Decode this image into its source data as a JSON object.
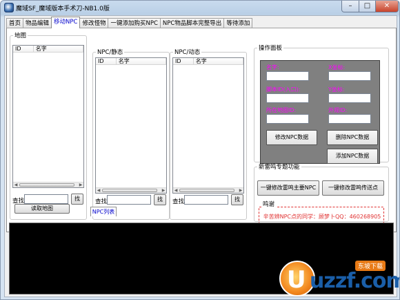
{
  "window": {
    "title": "魔域SF_魔域版本手术刀-NB1.0版",
    "min": "–",
    "max": "□",
    "close": "✕"
  },
  "tabs": [
    {
      "label": "首页"
    },
    {
      "label": "物品编辑"
    },
    {
      "label": "移动NPC"
    },
    {
      "label": "修改怪物"
    },
    {
      "label": "一键添加购买NPC"
    },
    {
      "label": "NPC物品脚本完整导出"
    },
    {
      "label": "等待添加"
    }
  ],
  "active_tab": "移动NPC",
  "map_group": {
    "legend": "地图",
    "columns": [
      "ID",
      "名字"
    ],
    "search_label": "查找",
    "search_value": "",
    "find_button": "找",
    "read_map_button": "读取地图"
  },
  "npc_static_group": {
    "legend": "NPC/静态",
    "columns": [
      "ID",
      "名字"
    ],
    "search_label": "查找",
    "search_value": "",
    "find_button": "找"
  },
  "npc_dynamic_group": {
    "legend": "NPC/动态",
    "columns": [
      "ID",
      "名字"
    ],
    "search_label": "查找",
    "search_value": "",
    "find_button": "找"
  },
  "npc_list_tab": "NPC列表",
  "ops_panel": {
    "legend": "操作面板",
    "fields": [
      {
        "label": "名字:",
        "value": ""
      },
      {
        "label": "X坐标:",
        "value": ""
      },
      {
        "label": "脚本ID(入口):",
        "value": ""
      },
      {
        "label": "Y坐标:",
        "value": ""
      },
      {
        "label": "所在地图ID:",
        "value": ""
      },
      {
        "label": "外观ID:",
        "value": ""
      }
    ],
    "modify_button": "修改NPC数据",
    "delete_button": "删除NPC数据",
    "add_button": "添加NPC数据"
  },
  "leiming_group": {
    "legend": "新雷鸣专题功能",
    "modify_main_button": "一键修改雷鸣主要NPC",
    "modify_teleport_button": "一键修改雷鸣传送点",
    "thanks_legend": "鸣谢",
    "thanks_text": "辛苦辨NPC点的同学：顾梦卜QQ：460268905"
  },
  "watermark": {
    "logo_letter": "U",
    "brand": "uzzf.com",
    "tag": "东坡下载"
  },
  "colors": {
    "label_magenta": "#ff00ff",
    "thanks_red": "#e03030",
    "active_tab_blue": "#0000cc",
    "panel_gray": "#808080"
  }
}
